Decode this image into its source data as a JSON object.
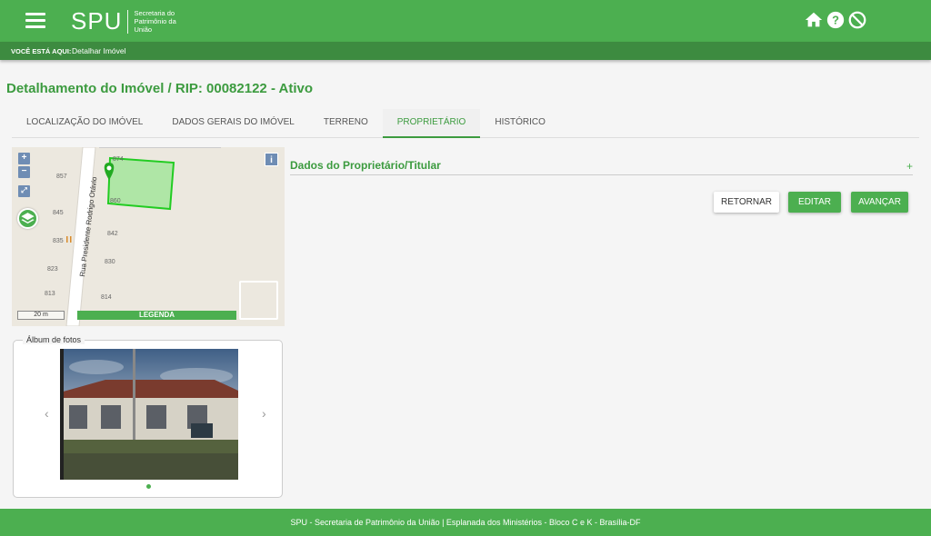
{
  "header": {
    "logo_text": "SPU",
    "logo_subtitle": "Secretaria do Patrimônio da União",
    "icons": [
      "menu-icon",
      "home-icon",
      "help-icon",
      "block-icon"
    ]
  },
  "breadcrumb": {
    "label": "VOCÊ ESTÁ AQUI:",
    "current": "Detalhar Imóvel"
  },
  "page": {
    "title": "Detalhamento do Imóvel / RIP: 00082122 - Ativo"
  },
  "tabs": [
    {
      "label": "LOCALIZAÇÃO DO IMÓVEL",
      "active": false
    },
    {
      "label": "DADOS GERAIS DO IMÓVEL",
      "active": false
    },
    {
      "label": "TERRENO",
      "active": false
    },
    {
      "label": "PROPRIETÁRIO",
      "active": true
    },
    {
      "label": "HISTÓRICO",
      "active": false
    }
  ],
  "map": {
    "zoom_in": "+",
    "zoom_out": "−",
    "info": "i",
    "street": "Rua Presidente Rodrigo Otávio",
    "lots": [
      "857",
      "845",
      "835",
      "823",
      "813",
      "842",
      "830",
      "814",
      "860",
      "874"
    ],
    "scale": "20 m",
    "legend": "LEGENDA",
    "colors": {
      "polygon_fill": "#a8e6a0",
      "polygon_stroke": "#22cc22",
      "pin": "#22aa22"
    }
  },
  "album": {
    "title": "Álbum de fotos",
    "prev": "‹",
    "next": "›"
  },
  "section": {
    "title": "Dados do Proprietário/Titular",
    "expand": "+"
  },
  "actions": {
    "return_label": "RETORNAR",
    "edit_label": "EDITAR",
    "next_label": "AVANÇAR"
  },
  "footer": {
    "text": "SPU - Secretaria de Patrimônio da União | Esplanada dos Ministérios - Bloco C e K - Brasília-DF"
  },
  "colors": {
    "primary": "#4caf50",
    "primary_dark": "#3d8b40",
    "title": "#3c9b3f"
  }
}
